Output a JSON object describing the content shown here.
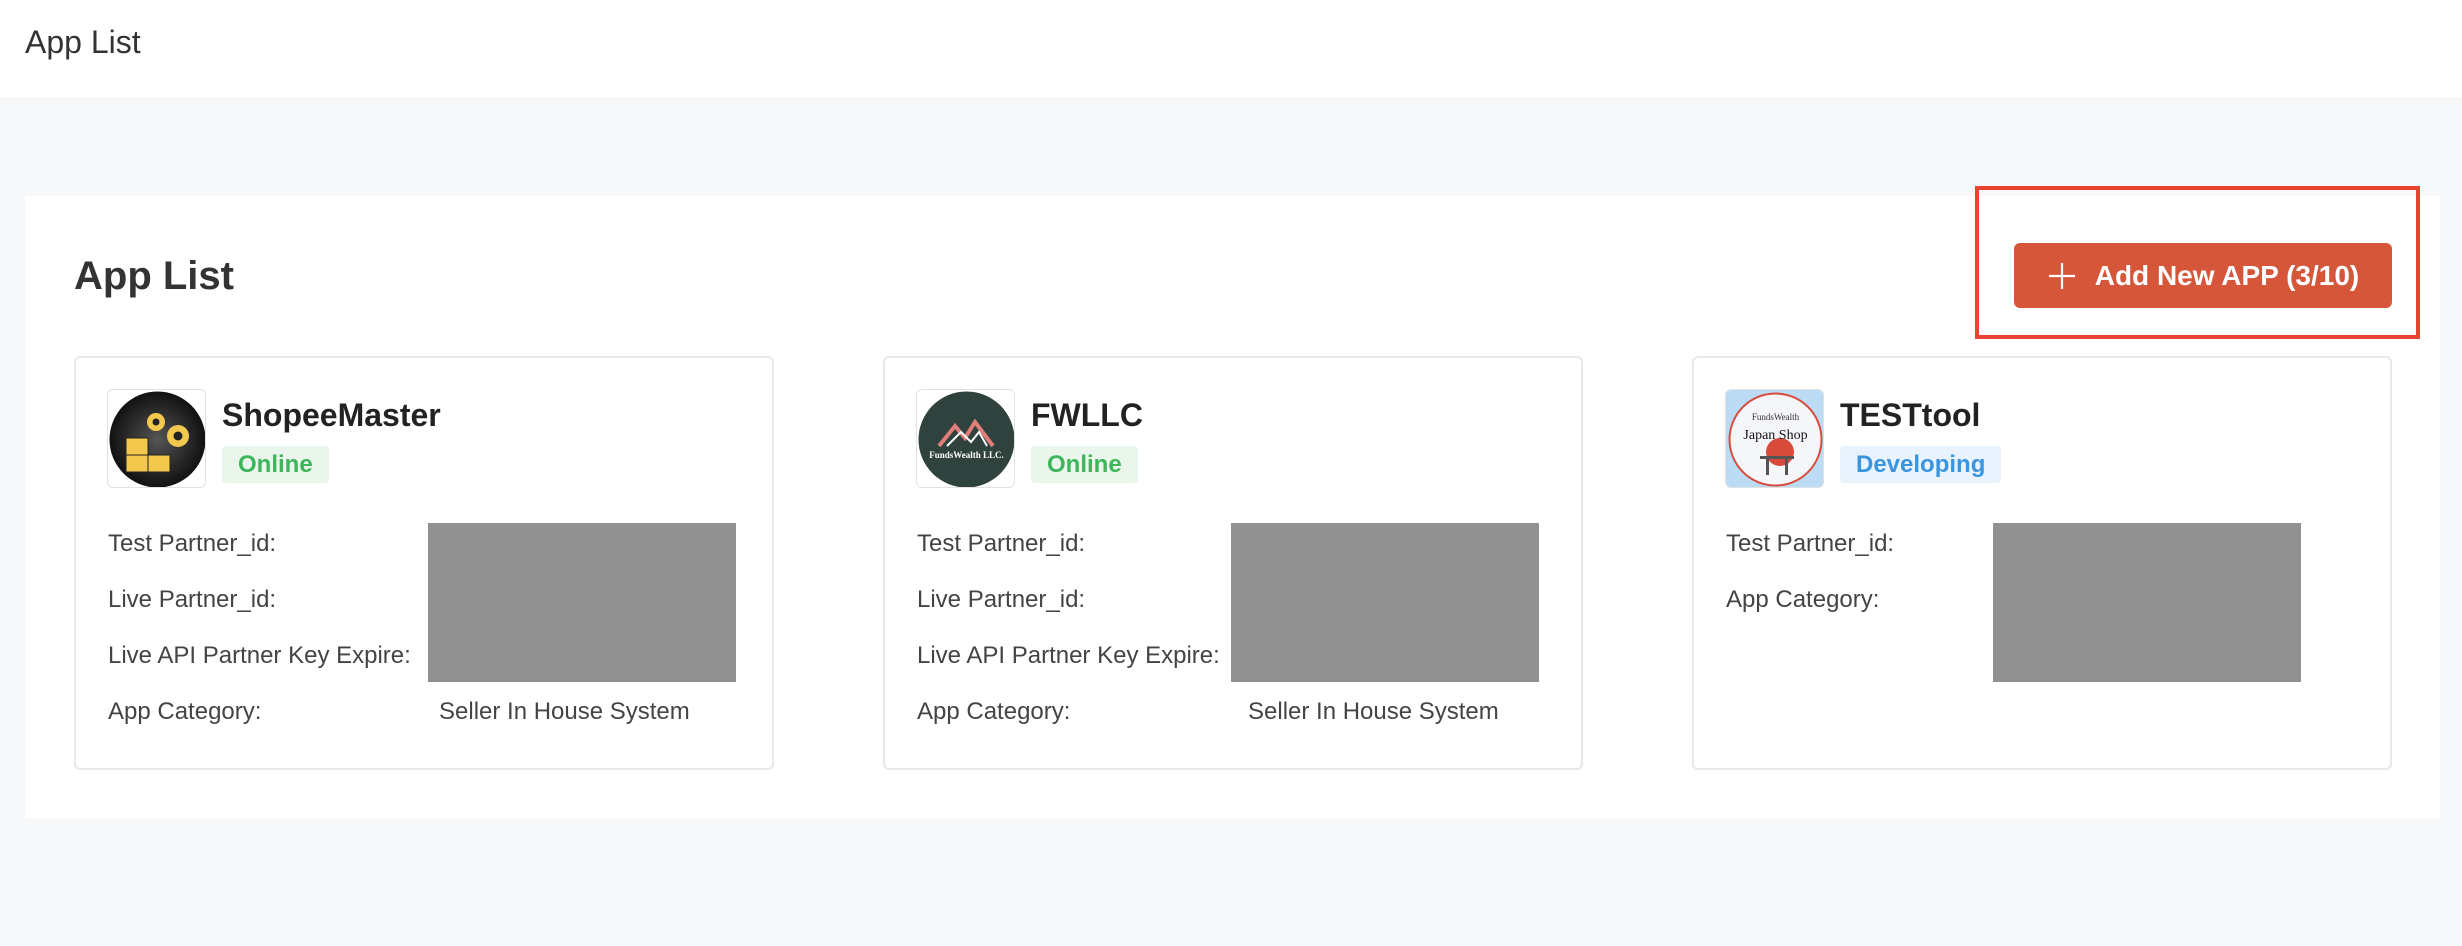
{
  "header": {
    "title": "App List"
  },
  "panel": {
    "title": "App List",
    "add_button_label": "Add New APP (3/10)"
  },
  "apps": [
    {
      "name": "ShopeeMaster",
      "status": "Online",
      "fields": {
        "test_partner": "Test Partner_id:",
        "live_partner": "Live Partner_id:",
        "live_key_expire": "Live API Partner Key Expire:",
        "category": "App Category:"
      },
      "category_value": "Seller In House System"
    },
    {
      "name": "FWLLC",
      "status": "Online",
      "logo_text": "FundsWealth LLC.",
      "fields": {
        "test_partner": "Test Partner_id:",
        "live_partner": "Live Partner_id:",
        "live_key_expire": "Live API Partner Key Expire:",
        "category": "App Category:"
      },
      "category_value": "Seller In House System"
    },
    {
      "name": "TESTtool",
      "status": "Developing",
      "logo_text_top": "FundsWealth",
      "logo_text_main": "Japan Shop",
      "fields": {
        "test_partner": "Test Partner_id:",
        "category": "App Category:"
      }
    }
  ],
  "colors": {
    "accent_button": "#d6563a",
    "highlight_border": "#e8432e",
    "online": "#3fb55a",
    "developing": "#3a95e0"
  }
}
